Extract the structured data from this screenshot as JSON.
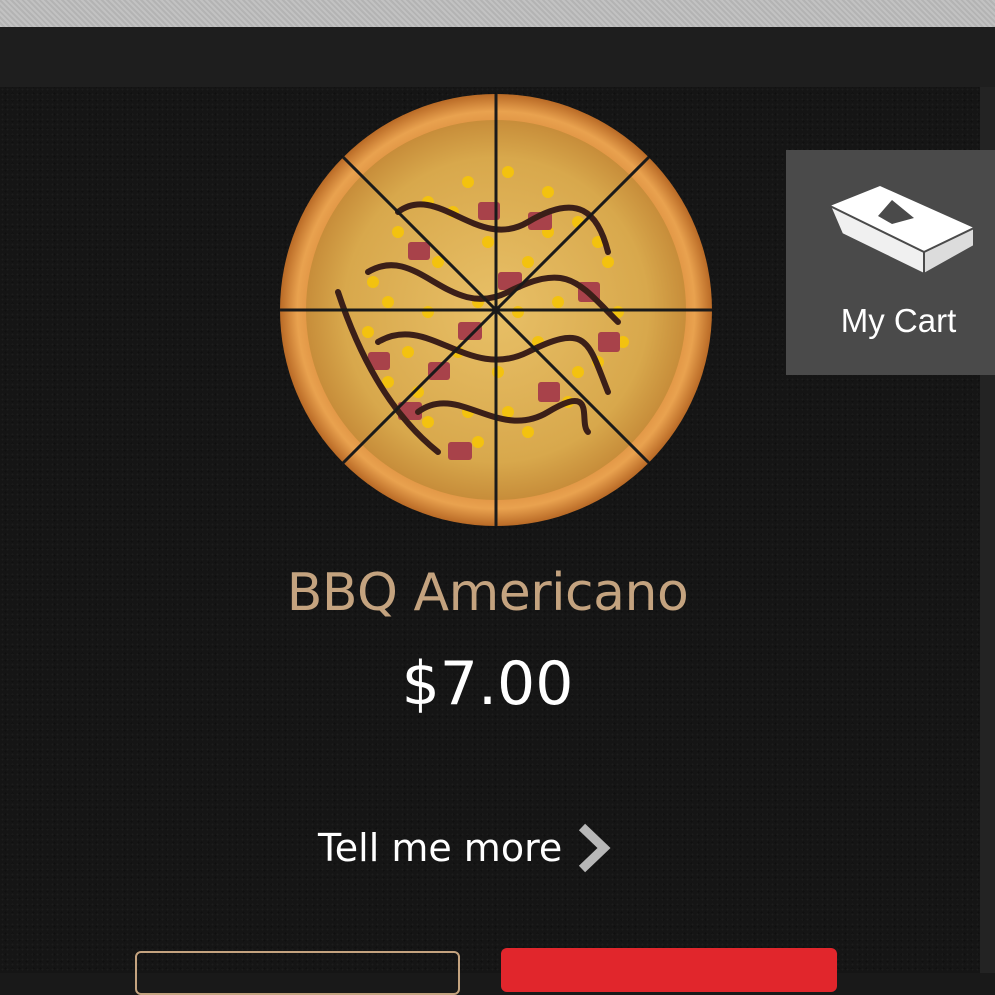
{
  "product": {
    "name": "BBQ Americano",
    "price": "$7.00",
    "details_link": "Tell me more",
    "image": "pizza-image"
  },
  "cart": {
    "label": "My Cart",
    "icon": "pizza-box-icon"
  },
  "colors": {
    "name_text": "#c4a37f",
    "background": "#191919",
    "cart_panel": "#4a4a4a",
    "primary_button": "#e1262c",
    "outline_button": "#c4a37f"
  }
}
